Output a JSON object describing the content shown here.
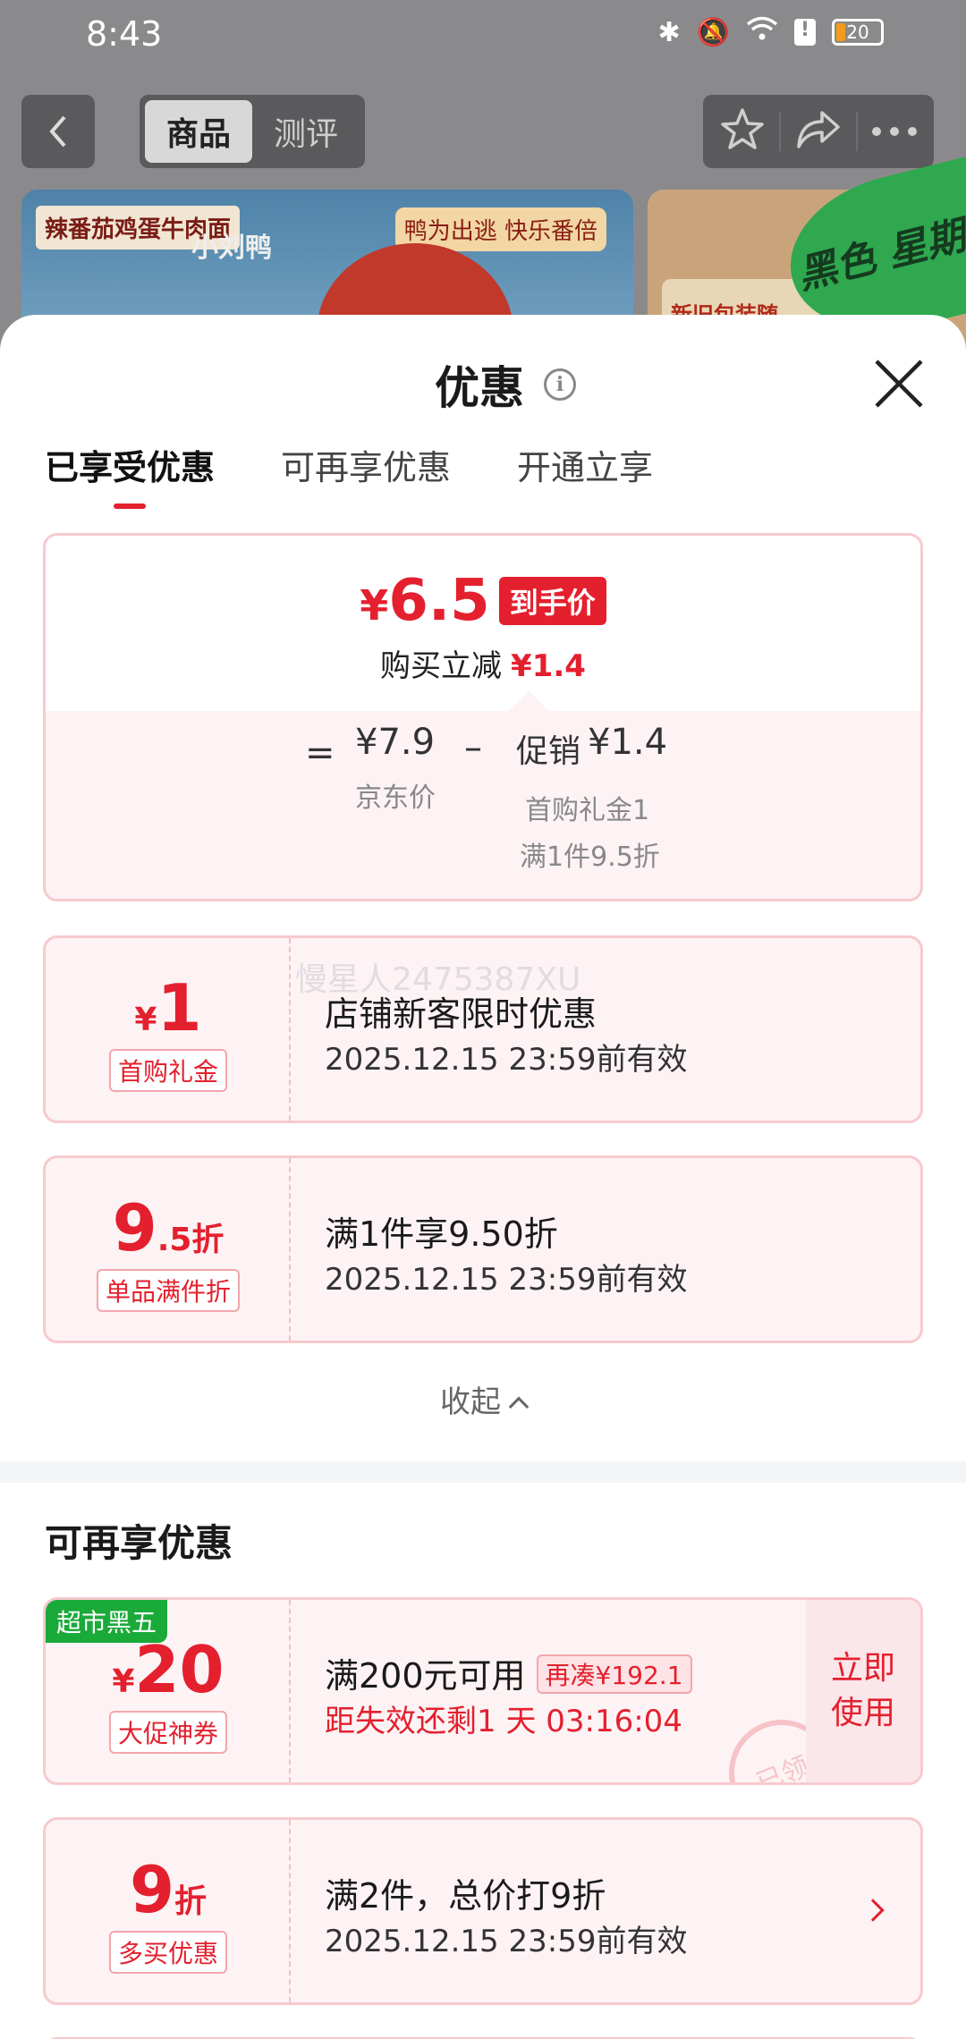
{
  "status_bar": {
    "time": "8:43",
    "battery": "20"
  },
  "nav": {
    "tabs": [
      "商品",
      "测评"
    ]
  },
  "banner": {
    "brand": "辣番茄鸡蛋牛肉面",
    "brand2": "小刘鸭",
    "tag": "鸭为出逃 快乐番倍",
    "right_text": "新旧包装随",
    "badge": "黑色 星期五"
  },
  "sheet": {
    "title": "优惠",
    "tabs": [
      "已享受优惠",
      "可再享优惠",
      "开通立享"
    ],
    "summary": {
      "final_currency": "¥",
      "final_price": "6.5",
      "final_tag": "到手价",
      "reduce_label": "购买立减",
      "reduce_value": "¥1.4",
      "eq": "=",
      "jd_price": "¥7.9",
      "jd_label": "京东价",
      "minus": "–",
      "promo_label": "促销",
      "promo_value": "¥1.4",
      "promo_note1": "首购礼金1",
      "promo_note2": "满1件9.5折"
    },
    "watermark": "慢星人2475387XU",
    "enjoyed_coupons": [
      {
        "amount_prefix": "¥",
        "amount": "1",
        "amount_suffix": "",
        "type": "首购礼金",
        "title": "店铺新客限时优惠",
        "validity": "2025.12.15 23:59前有效"
      },
      {
        "amount_prefix": "",
        "amount": "9",
        "amount_suffix": ".5折",
        "type": "单品满件折",
        "title": "满1件享9.50折",
        "validity": "2025.12.15 23:59前有效"
      }
    ],
    "collapse_label": "收起",
    "more_section_title": "可再享优惠",
    "more_coupons": [
      {
        "corner_tag": "超市黑五",
        "amount_prefix": "¥",
        "amount": "20",
        "amount_suffix": "",
        "type": "大促神券",
        "title": "满200元可用",
        "addon": "再凑¥192.1",
        "countdown": "距失效还剩1 天 03:16:04",
        "button_line1": "立即",
        "button_line2": "使用",
        "stamp": "已领"
      },
      {
        "amount_prefix": "",
        "amount": "9",
        "amount_suffix": "折",
        "type": "多买优惠",
        "title": "满2件，总价打9折",
        "validity": "2025.12.15 23:59前有效"
      }
    ]
  },
  "colors": {
    "accent": "#e4202e",
    "green_tag": "#1aaa3a"
  }
}
